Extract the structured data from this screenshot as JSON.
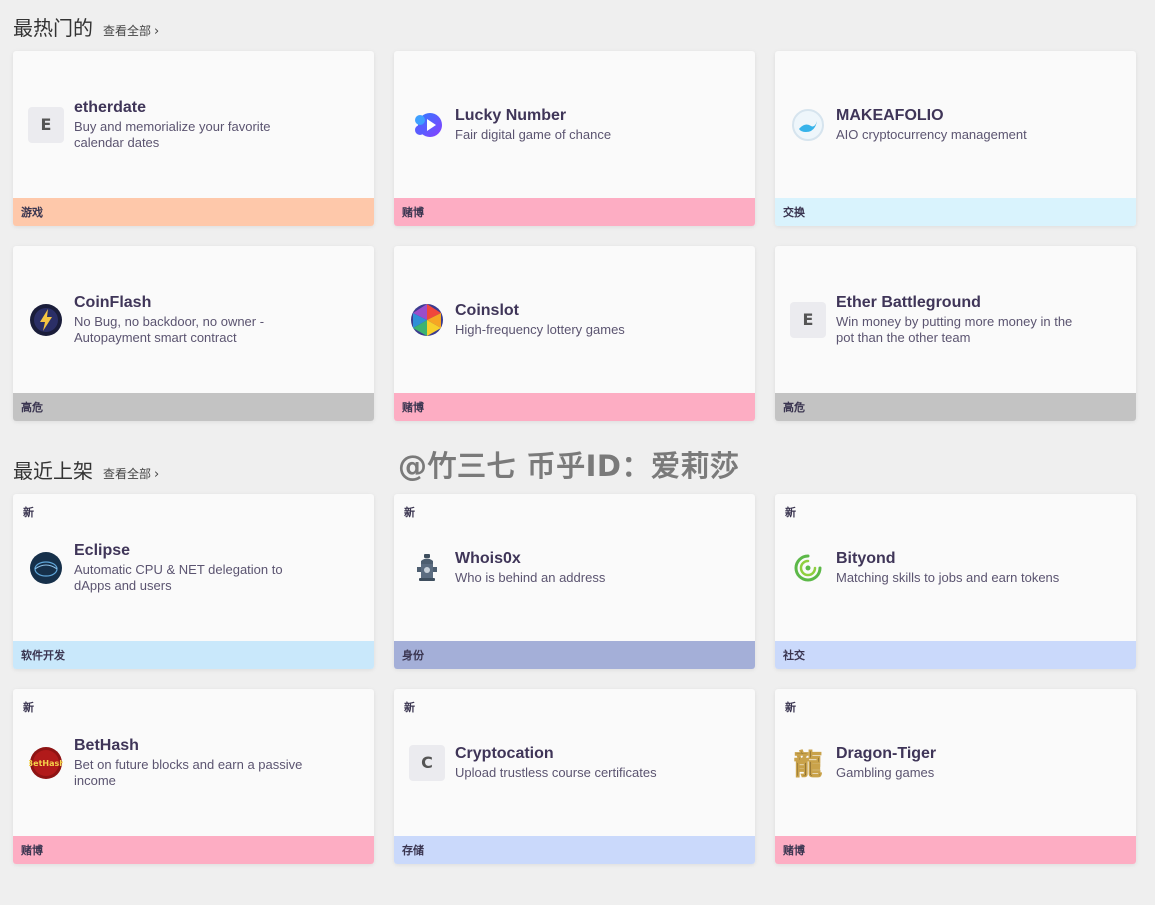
{
  "hot": {
    "title": "最热门的",
    "view_all": "查看全部",
    "cards": [
      {
        "name": "etherdate",
        "desc": "Buy and memorialize your favorite calendar dates",
        "logo_letter": "E",
        "logo_icon": "letter-e-icon",
        "category": "游戏",
        "category_color": "#fec8aa"
      },
      {
        "name": "Lucky Number",
        "desc": "Fair digital game of chance",
        "logo_letter": "",
        "logo_icon": "play-gradient-icon",
        "category": "赌博",
        "category_color": "#fdadc3"
      },
      {
        "name": "MAKEAFOLIO",
        "desc": "AIO cryptocurrency management",
        "logo_letter": "",
        "logo_icon": "wave-circle-icon",
        "category": "交换",
        "category_color": "#d9f3fd"
      },
      {
        "name": "CoinFlash",
        "desc": "No Bug, no backdoor, no owner - Autopayment smart contract",
        "logo_letter": "",
        "logo_icon": "lightning-coin-icon",
        "category": "高危",
        "category_color": "#c3c3c3"
      },
      {
        "name": "Coinslot",
        "desc": "High-frequency lottery games",
        "logo_letter": "",
        "logo_icon": "polygon-ball-icon",
        "category": "赌博",
        "category_color": "#fdadc3"
      },
      {
        "name": "Ether Battleground",
        "desc": "Win money by putting more money in the pot than the other team",
        "logo_letter": "E",
        "logo_icon": "letter-e-icon",
        "category": "高危",
        "category_color": "#c3c3c3"
      }
    ]
  },
  "recent": {
    "title": "最近上架",
    "view_all": "查看全部",
    "new_label": "新",
    "cards": [
      {
        "name": "Eclipse",
        "desc": "Automatic CPU & NET delegation to dApps and users",
        "logo_letter": "",
        "logo_icon": "eclipse-icon",
        "category": "软件开发",
        "category_color": "#c9e8fb"
      },
      {
        "name": "Whois0x",
        "desc": "Who is behind an address",
        "logo_letter": "",
        "logo_icon": "hydrant-icon",
        "category": "身份",
        "category_color": "#a4afd8"
      },
      {
        "name": "Bityond",
        "desc": "Matching skills to jobs and earn tokens",
        "logo_letter": "",
        "logo_icon": "green-swirl-icon",
        "category": "社交",
        "category_color": "#cad9fb"
      },
      {
        "name": "BetHash",
        "desc": "Bet on future blocks and earn a passive income",
        "logo_letter": "",
        "logo_icon": "bethash-logo-icon",
        "category": "赌博",
        "category_color": "#fdadc3"
      },
      {
        "name": "Cryptocation",
        "desc": "Upload trustless course certificates",
        "logo_letter": "C",
        "logo_icon": "letter-c-icon",
        "category": "存储",
        "category_color": "#cad9fb"
      },
      {
        "name": "Dragon-Tiger",
        "desc": "Gambling games",
        "logo_letter": "",
        "logo_icon": "dragon-glyph-icon",
        "category": "赌博",
        "category_color": "#fdadc3"
      }
    ]
  },
  "watermark": "@竹三七 币乎ID：爱莉莎",
  "icon_text": {
    "bethash": "BetHash",
    "dragon": "龍"
  }
}
